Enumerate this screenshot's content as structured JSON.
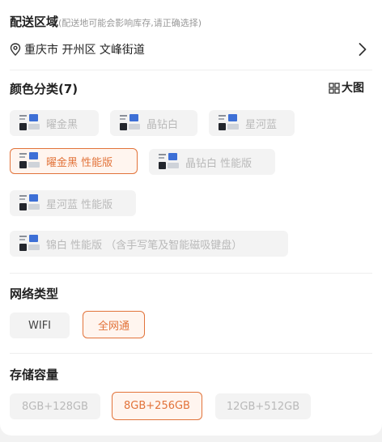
{
  "delivery": {
    "title": "配送区域",
    "note": "(配送地可能会影响库存,请正确选择)",
    "address": "重庆市 开州区 文峰街道"
  },
  "color": {
    "title": "颜色分类(7)",
    "big_image_label": "大图",
    "options": [
      {
        "label": "曜金黑",
        "state": "unavailable"
      },
      {
        "label": "晶钻白",
        "state": "unavailable"
      },
      {
        "label": "星河蓝",
        "state": "unavailable"
      },
      {
        "label": "曜金黑 性能版",
        "state": "selected"
      },
      {
        "label": "晶钻白 性能版",
        "state": "unavailable"
      },
      {
        "label": "星河蓝 性能版",
        "state": "unavailable"
      },
      {
        "label": "锦白 性能版 （含手写笔及智能磁吸键盘）",
        "state": "unavailable"
      }
    ]
  },
  "network": {
    "title": "网络类型",
    "options": [
      {
        "label": "WIFI",
        "state": "normal"
      },
      {
        "label": "全网通",
        "state": "selected"
      }
    ]
  },
  "storage": {
    "title": "存储容量",
    "options": [
      {
        "label": "8GB+128GB",
        "state": "unavailable"
      },
      {
        "label": "8GB+256GB",
        "state": "selected"
      },
      {
        "label": "12GB+512GB",
        "state": "unavailable"
      }
    ]
  },
  "colors": {
    "accent": "#e2733a",
    "selected_bg": "#fff5ef",
    "chip_bg": "#f3f3f3",
    "unavailable_text": "#b9b9b9"
  }
}
